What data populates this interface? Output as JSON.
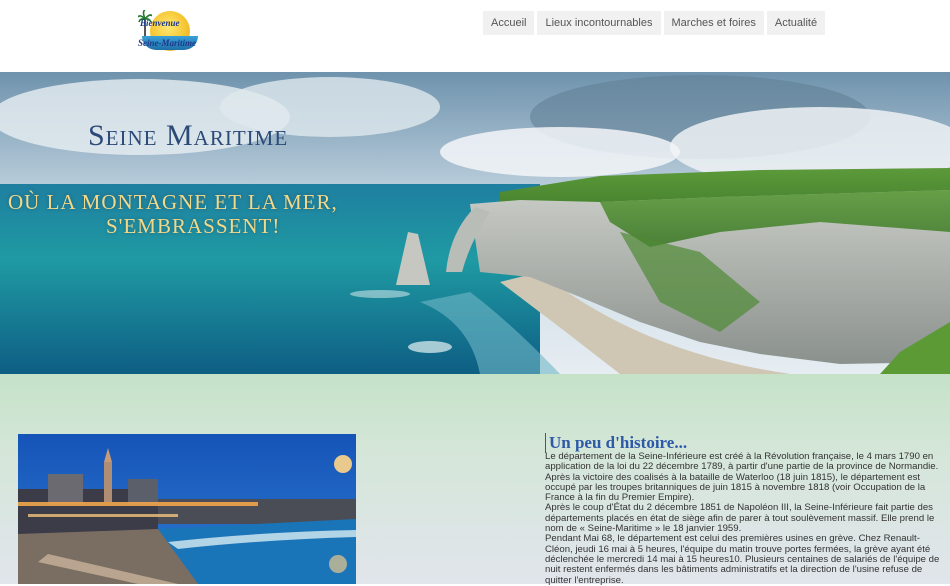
{
  "logo": {
    "line1": "Bienvenue",
    "line2": "Seine-Maritime"
  },
  "nav": {
    "items": [
      {
        "label": "Accueil"
      },
      {
        "label": "Lieux incontournables"
      },
      {
        "label": "Marches et foires"
      },
      {
        "label": "Actualité"
      }
    ]
  },
  "hero": {
    "title": "Seine Maritime",
    "subtitle_line1": "Où la montagne et la mer,",
    "subtitle_line2": "s'embrassent!"
  },
  "history": {
    "title": "Un peu d'histoire...",
    "paragraphs": [
      "Le département de la Seine-Inférieure est créé à la Révolution française, le 4 mars 1790 en application de la loi du 22 décembre 1789, à partir d'une partie de la province de Normandie.",
      "Après la victoire des coalisés à la bataille de Waterloo (18 juin 1815), le département est occupé par les troupes britanniques de juin 1815 à novembre 1818 (voir Occupation de la France à la fin du Premier Empire).",
      "Après le coup d'État du 2 décembre 1851 de Napoléon III, la Seine-Inférieure fait partie des départements placés en état de siège afin de parer à tout soulèvement massif. Elle prend le nom de « Seine-Maritime » le 18 janvier 1959.",
      "Pendant Mai 68, le département est celui des premières usines en grève. Chez Renault-Cléon, jeudi 16 mai à 5 heures, l'équipe du matin trouve portes fermées, la grève ayant été déclenchée le mercredi 14 mai à 15 heures10. Plusieurs centaines de salariés de l'équipe de nuit restent enfermés dans les bâtiments administratifs et la direction de l'usine refuse de quitter l'entreprise."
    ]
  },
  "colors": {
    "title_blue": "#2c4a78",
    "subtitle_gold": "#f1d98a",
    "history_blue": "#2c5aa8"
  }
}
